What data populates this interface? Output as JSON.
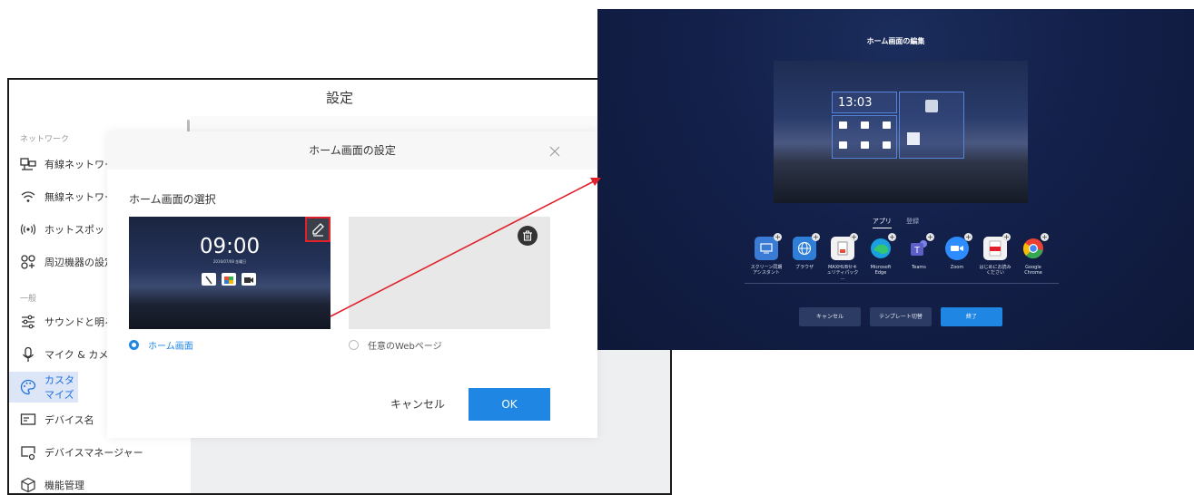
{
  "settings": {
    "title": "設定",
    "sidebar": {
      "section_network": "ネットワーク",
      "section_general": "一般",
      "items": [
        {
          "label": "有線ネットワーク"
        },
        {
          "label": "無線ネットワーク"
        },
        {
          "label": "ホットスポット"
        },
        {
          "label": "周辺機器の設定"
        },
        {
          "label": "サウンドと明るさ"
        },
        {
          "label": "マイク & カメラ"
        },
        {
          "label": "カスタマイズ"
        },
        {
          "label": "デバイス名"
        },
        {
          "label": "デバイスマネージャー"
        },
        {
          "label": "機能管理"
        }
      ]
    }
  },
  "dialog": {
    "title": "ホーム画面の設定",
    "section_title": "ホーム画面の選択",
    "home_thumb": {
      "time": "09:00",
      "date": "2016/07/08 金曜日"
    },
    "option_home": "ホーム画面",
    "option_web": "任意のWebページ",
    "cancel": "キャンセル",
    "ok": "OK"
  },
  "edit_screen": {
    "title": "ホーム画面の編集",
    "preview_time": "13:03",
    "tabs": {
      "apps": "アプリ",
      "registered": "登録"
    },
    "apps": [
      {
        "label": "スクリーン同期\nアシスタント",
        "color": "#3a7bd5"
      },
      {
        "label": "ブラウザ",
        "color": "#2f7fd8"
      },
      {
        "label": "MAXHUBセキ\nュリティパック ...",
        "color": "#f2f2f2"
      },
      {
        "label": "Microsoft\nEdge",
        "color": "#1aa0e0"
      },
      {
        "label": "Teams",
        "color": "#5b5fc7"
      },
      {
        "label": "Zoom",
        "color": "#2d8cff"
      },
      {
        "label": "はじめにお読み\nください",
        "color": "#f2f2f2"
      },
      {
        "label": "Google\nChrome",
        "color": "#f2f2f2"
      }
    ],
    "buttons": {
      "cancel": "キャンセル",
      "switch": "テンプレート切替",
      "done": "終了"
    }
  },
  "colors": {
    "accent": "#1f86e4",
    "arrow": "#e0202a"
  }
}
